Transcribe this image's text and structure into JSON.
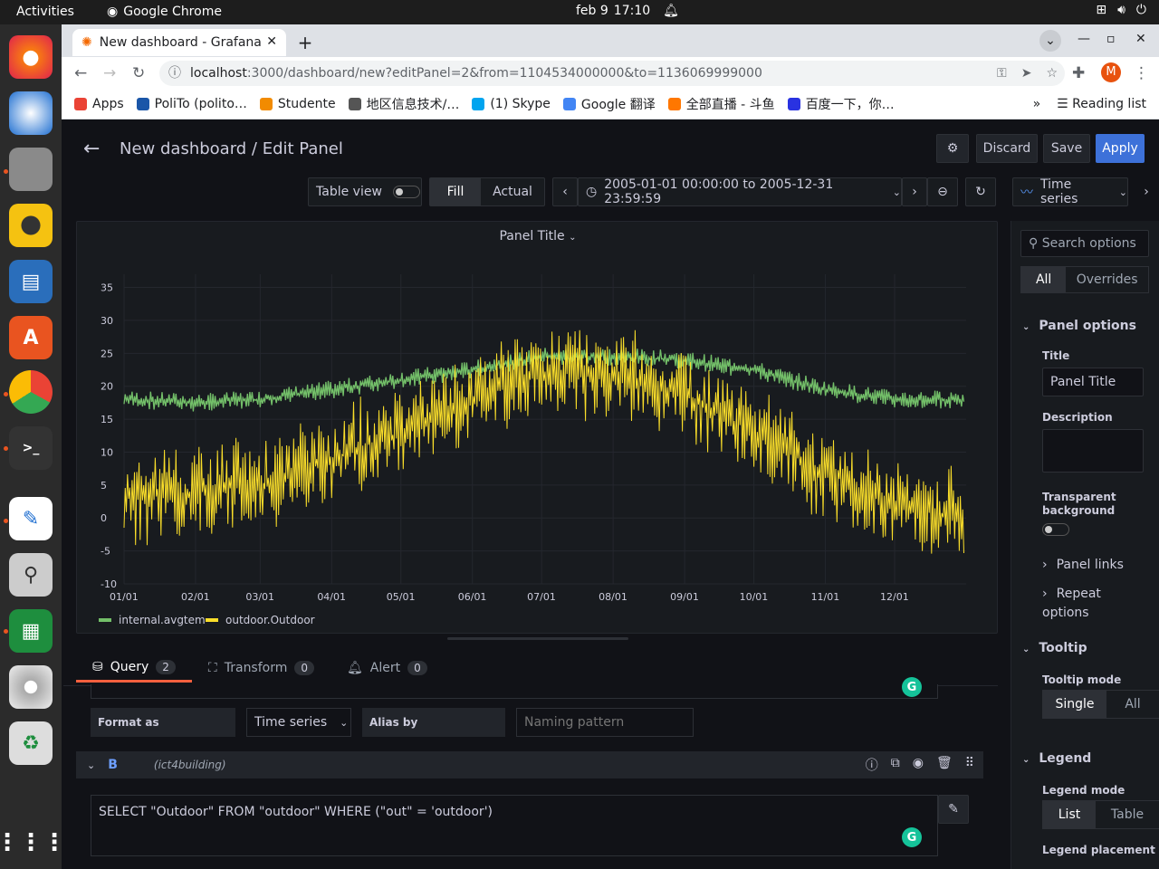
{
  "system": {
    "activities": "Activities",
    "app_name": "Google Chrome",
    "date": "feb 9",
    "time": "17:10"
  },
  "browser": {
    "tab_title": "New dashboard - Grafana",
    "url_host": "localhost",
    "url_rest": ":3000/dashboard/new?editPanel=2&from=1104534000000&to=1136069999000",
    "profile_letter": "M",
    "bookmarks": [
      {
        "label": "Apps",
        "color": "#ea4335"
      },
      {
        "label": "PoliTo (polito…",
        "color": "#1a56a8"
      },
      {
        "label": "Studente",
        "color": "#f28b00"
      },
      {
        "label": "地区信息技术/…",
        "color": "#555555"
      },
      {
        "label": "(1) Skype",
        "color": "#00a4ef"
      },
      {
        "label": "Google 翻译",
        "color": "#4285f4"
      },
      {
        "label": "全部直播 - 斗鱼",
        "color": "#ff7700"
      },
      {
        "label": "百度一下，你…",
        "color": "#2932e1"
      }
    ],
    "reading_list": "Reading list"
  },
  "header": {
    "title": "New dashboard / Edit Panel",
    "discard": "Discard",
    "save": "Save",
    "apply": "Apply"
  },
  "toolbar": {
    "table_view": "Table view",
    "fill": "Fill",
    "actual": "Actual",
    "time_range": "2005-01-01 00:00:00 to 2005-12-31 23:59:59",
    "viz": "Time series"
  },
  "panel": {
    "title": "Panel Title"
  },
  "chart_data": {
    "type": "line",
    "x_ticks": [
      "01/01",
      "02/01",
      "03/01",
      "04/01",
      "05/01",
      "06/01",
      "07/01",
      "08/01",
      "09/01",
      "10/01",
      "11/01",
      "12/01"
    ],
    "y_ticks": [
      "35",
      "30",
      "25",
      "20",
      "15",
      "10",
      "5",
      "0",
      "-5",
      "-10"
    ],
    "ylim": [
      -10,
      37
    ],
    "grid": true,
    "legend_placement": "bottom-left",
    "series": [
      {
        "name": "internal.avgtem",
        "color": "#73bf69",
        "x": [
          "01/01",
          "02/01",
          "03/01",
          "04/01",
          "05/01",
          "06/01",
          "07/01",
          "08/01",
          "09/01",
          "10/01",
          "11/01",
          "12/01",
          "12/31"
        ],
        "values": [
          18,
          17.5,
          18,
          19.5,
          21,
          22.5,
          24.5,
          24.5,
          24,
          22.5,
          19.5,
          18,
          18
        ]
      },
      {
        "name": "outdoor.Outdoor",
        "color": "#fade2a",
        "x": [
          "01/01",
          "02/01",
          "03/01",
          "04/01",
          "05/01",
          "06/01",
          "07/01",
          "08/01",
          "09/01",
          "10/01",
          "11/01",
          "12/01",
          "12/31"
        ],
        "values": [
          3,
          4,
          5,
          9,
          13,
          18,
          22,
          22,
          19,
          13,
          7,
          2,
          0
        ]
      }
    ]
  },
  "query": {
    "tabs": [
      {
        "label": "Query",
        "count": "2"
      },
      {
        "label": "Transform",
        "count": "0"
      },
      {
        "label": "Alert",
        "count": "0"
      }
    ],
    "format_label": "Format as",
    "format_value": "Time series",
    "alias_label": "Alias by",
    "alias_placeholder": "Naming pattern",
    "ref": "B",
    "datasource": "(ict4building)",
    "sql": "SELECT \"Outdoor\" FROM \"outdoor\" WHERE (\"out\" = 'outdoor')"
  },
  "options": {
    "search_placeholder": "Search options",
    "all": "All",
    "overrides": "Overrides",
    "panel_options": "Panel options",
    "title_label": "Title",
    "title_value": "Panel Title",
    "description_label": "Description",
    "transparent_label": "Transparent background",
    "panel_links": "Panel links",
    "repeat_options": "Repeat options",
    "tooltip": "Tooltip",
    "tooltip_mode": "Tooltip mode",
    "single": "Single",
    "all_mode": "All",
    "legend": "Legend",
    "legend_mode": "Legend mode",
    "list": "List",
    "table": "Table",
    "legend_placement": "Legend placement"
  }
}
